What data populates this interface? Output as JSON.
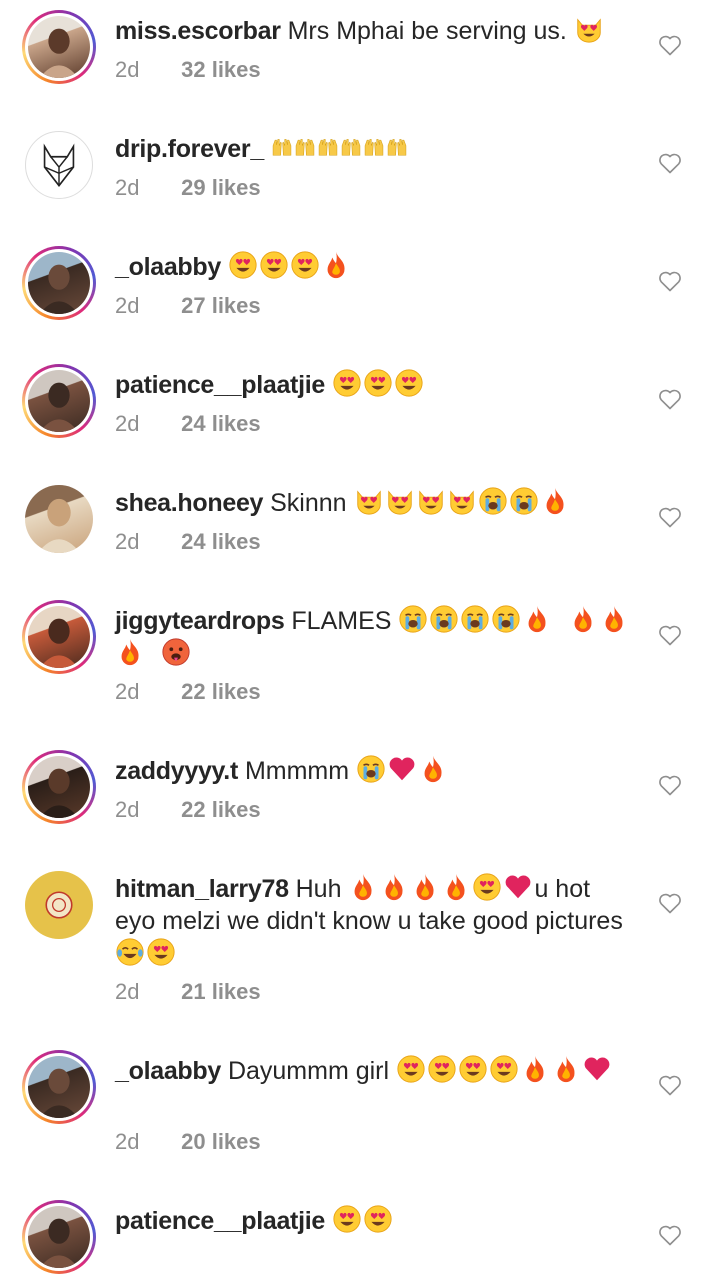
{
  "comments": [
    {
      "username": "miss.escorbar",
      "text": "Mrs Mphai be serving us.",
      "emojis_after": [
        "smiling-cat-heart-eyes"
      ],
      "time": "2d",
      "likes": "32 likes",
      "ring": true,
      "avatar_colors": [
        "#5b3a2a",
        "#c9a58a",
        "#e7e1d8"
      ]
    },
    {
      "username": "drip.forever_",
      "text": "",
      "emojis_after": [
        "raising-hands",
        "raising-hands",
        "raising-hands",
        "raising-hands",
        "raising-hands",
        "raising-hands"
      ],
      "time": "2d",
      "likes": "29 likes",
      "ring": false,
      "avatar_colors": [
        "#ffffff",
        "#222222",
        "#ffffff"
      ]
    },
    {
      "username": "_olaabby",
      "text": "",
      "emojis_after": [
        "heart-eyes",
        "heart-eyes",
        "heart-eyes",
        "fire"
      ],
      "time": "2d",
      "likes": "27 likes",
      "ring": true,
      "avatar_colors": [
        "#6a4a3a",
        "#3a2a22",
        "#9db6c9"
      ]
    },
    {
      "username": "patience__plaatjie",
      "text": "",
      "emojis_after": [
        "heart-eyes",
        "heart-eyes",
        "heart-eyes"
      ],
      "time": "2d",
      "likes": "24 likes",
      "ring": true,
      "avatar_colors": [
        "#3b2a22",
        "#7a5240",
        "#cfc7c0"
      ]
    },
    {
      "username": "shea.honeey",
      "text": "Skinnn",
      "emojis_after": [
        "smiling-cat-heart-eyes",
        "smiling-cat-heart-eyes",
        "smiling-cat-heart-eyes",
        "smiling-cat-heart-eyes",
        "loudly-crying",
        "loudly-crying",
        "fire"
      ],
      "time": "2d",
      "likes": "24 likes",
      "ring": false,
      "avatar_colors": [
        "#c9a27a",
        "#e8d9c2",
        "#8a6a50"
      ]
    },
    {
      "username": "jiggyteardrops",
      "text": "FLAMES",
      "emojis_after": [
        "loudly-crying",
        "loudly-crying",
        "loudly-crying",
        "loudly-crying",
        "fire",
        "space",
        "fire",
        "fire",
        "fire",
        "space",
        "hot-face"
      ],
      "time": "2d",
      "likes": "22 likes",
      "ring": true,
      "avatar_colors": [
        "#4a2a1e",
        "#c65a3a",
        "#e7d6c4"
      ]
    },
    {
      "username": "zaddyyyy.t",
      "text": "Mmmmm",
      "emojis_after": [
        "loudly-crying",
        "red-heart",
        "fire"
      ],
      "time": "2d",
      "likes": "22 likes",
      "ring": true,
      "avatar_colors": [
        "#5a3a2a",
        "#2a1e18",
        "#d9cfc8"
      ]
    },
    {
      "username": "hitman_larry78",
      "text_parts": [
        "Huh",
        "u hot eyo melzi we didn't know u take good pictures"
      ],
      "emojis_mid": [
        "fire",
        "fire",
        "fire",
        "fire",
        "heart-eyes",
        "red-heart"
      ],
      "emojis_after": [
        "tears-of-joy",
        "heart-eyes"
      ],
      "time": "2d",
      "likes": "21 likes",
      "ring": false,
      "avatar_colors": [
        "#e6c24a",
        "#f3e6c6",
        "#c0392b"
      ]
    },
    {
      "username": "_olaabby",
      "text": "Dayummm girl",
      "emojis_after": [
        "heart-eyes",
        "heart-eyes",
        "heart-eyes",
        "heart-eyes",
        "fire",
        "fire",
        "red-heart"
      ],
      "time": "2d",
      "likes": "20 likes",
      "ring": true,
      "avatar_colors": [
        "#6a4a3a",
        "#3a2a22",
        "#9db6c9"
      ]
    },
    {
      "username": "patience__plaatjie",
      "text": "",
      "emojis_after": [
        "heart-eyes",
        "heart-eyes"
      ],
      "time": "",
      "likes": "",
      "ring": true,
      "avatar_colors": [
        "#3b2a22",
        "#7a5240",
        "#cfc7c0"
      ]
    }
  ]
}
